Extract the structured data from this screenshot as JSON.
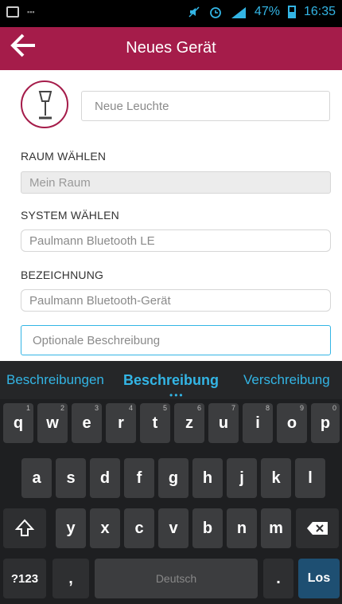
{
  "statusbar": {
    "battery": "47%",
    "time": "16:35",
    "icons": [
      "image-icon",
      "mute-icon",
      "alarm-icon",
      "signal-icon",
      "battery-icon"
    ]
  },
  "appbar": {
    "title": "Neues Gerät",
    "back_icon": "arrow-left-icon"
  },
  "form": {
    "name_placeholder": "Neue Leuchte",
    "room_label": "RAUM WÄHLEN",
    "room_value": "Mein Raum",
    "system_label": "SYSTEM WÄHLEN",
    "system_value": "Paulmann Bluetooth LE",
    "name_label": "BEZEICHNUNG",
    "name_value": "Paulmann Bluetooth-Gerät",
    "description_placeholder": "Optionale Beschreibung"
  },
  "keyboard": {
    "suggestions": [
      "Beschreibungen",
      "Beschreibung",
      "Verschreibung"
    ],
    "row1": [
      [
        "q",
        "1"
      ],
      [
        "w",
        "2"
      ],
      [
        "e",
        "3"
      ],
      [
        "r",
        "4"
      ],
      [
        "t",
        "5"
      ],
      [
        "z",
        "6"
      ],
      [
        "u",
        "7"
      ],
      [
        "i",
        "8"
      ],
      [
        "o",
        "9"
      ],
      [
        "p",
        "0"
      ]
    ],
    "row2": [
      "a",
      "s",
      "d",
      "f",
      "g",
      "h",
      "j",
      "k",
      "l"
    ],
    "row3": [
      "y",
      "x",
      "c",
      "v",
      "b",
      "n",
      "m"
    ],
    "symbols_label": "?123",
    "comma_label": ",",
    "space_label": "Deutsch",
    "period_label": ".",
    "enter_label": "Los",
    "accent_color": "#33b5e5",
    "brand_color": "#a51c4a"
  }
}
